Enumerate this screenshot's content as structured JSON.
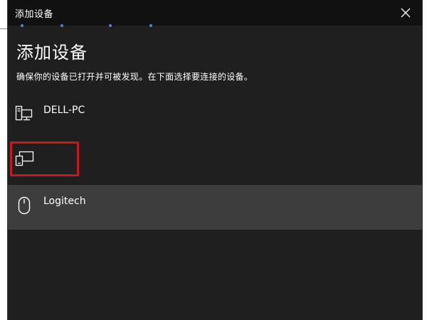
{
  "window": {
    "title": "添加设备",
    "close_icon": "close-icon"
  },
  "main": {
    "heading": "添加设备",
    "instruction": "确保你的设备已打开并可被发现。在下面选择要连接的设备。"
  },
  "devices": [
    {
      "name": "DELL-PC",
      "icon": "computer-icon",
      "selected": false,
      "highlighted": false
    },
    {
      "name": "",
      "icon": "display-device-icon",
      "selected": false,
      "highlighted": true
    },
    {
      "name": "Logitech",
      "icon": "mouse-icon",
      "selected": true,
      "highlighted": false
    }
  ],
  "colors": {
    "dialog_background": "#1f1f1f",
    "titlebar_background": "#111111",
    "selected_row": "#3d3d3d",
    "progress_dots": "#3b8fd6",
    "highlight_box": "#c8181e",
    "text": "#ffffff"
  }
}
